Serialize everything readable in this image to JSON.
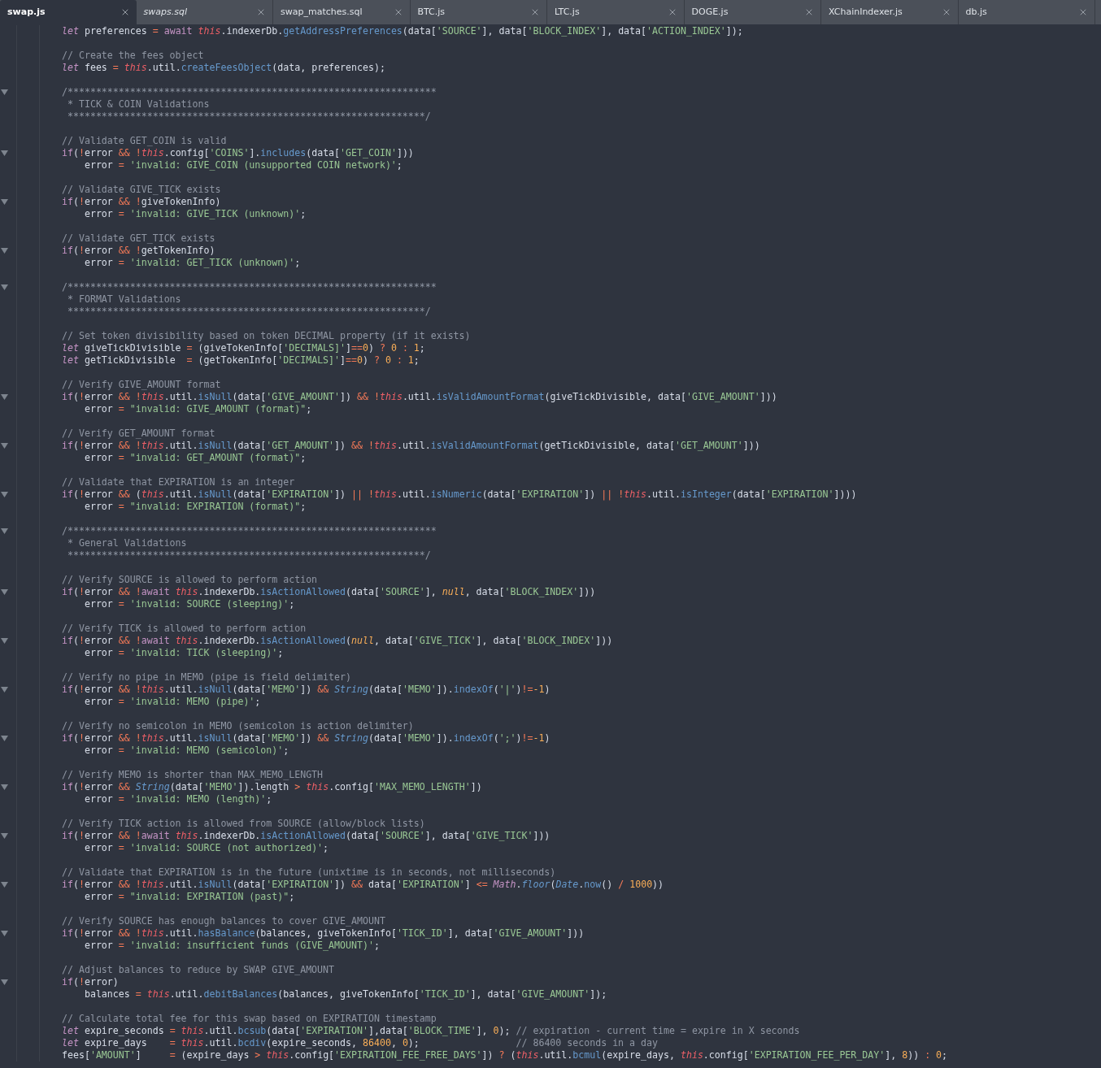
{
  "tabs": [
    {
      "label": "swap.js",
      "selected": true,
      "preview": false
    },
    {
      "label": "swaps.sql",
      "selected": false,
      "preview": true
    },
    {
      "label": "swap_matches.sql",
      "selected": false,
      "preview": false
    },
    {
      "label": "BTC.js",
      "selected": false,
      "preview": false
    },
    {
      "label": "LTC.js",
      "selected": false,
      "preview": false
    },
    {
      "label": "DOGE.js",
      "selected": false,
      "preview": false
    },
    {
      "label": "XChainIndexer.js",
      "selected": false,
      "preview": false
    },
    {
      "label": "db.js",
      "selected": false,
      "preview": false
    }
  ],
  "lines": [
    {
      "fold": false,
      "tokens": [
        {
          "kind": "storage",
          "text": "let"
        },
        {
          "kind": "text",
          "text": " preferences "
        },
        {
          "kind": "operator",
          "text": "= "
        },
        {
          "kind": "keyword",
          "text": "await "
        },
        {
          "kind": "self",
          "text": "this"
        },
        {
          "kind": "text",
          "text": ".indexerDb."
        },
        {
          "kind": "call",
          "text": "getAddressPreferences"
        },
        {
          "kind": "text",
          "text": "(data["
        },
        {
          "kind": "string",
          "text": "'SOURCE'"
        },
        {
          "kind": "text",
          "text": "], data["
        },
        {
          "kind": "string",
          "text": "'BLOCK_INDEX'"
        },
        {
          "kind": "text",
          "text": "], data["
        },
        {
          "kind": "string",
          "text": "'ACTION_INDEX'"
        },
        {
          "kind": "text",
          "text": "]);"
        }
      ]
    },
    {
      "fold": false
    },
    {
      "fold": false,
      "tokens": [
        {
          "kind": "comment",
          "text": "// Create the fees object"
        }
      ]
    },
    {
      "fold": false,
      "tokens": [
        {
          "kind": "storage",
          "text": "let"
        },
        {
          "kind": "text",
          "text": " fees "
        },
        {
          "kind": "operator",
          "text": "= "
        },
        {
          "kind": "self",
          "text": "this"
        },
        {
          "kind": "text",
          "text": ".util."
        },
        {
          "kind": "call",
          "text": "createFeesObject"
        },
        {
          "kind": "text",
          "text": "(data, preferences);"
        }
      ]
    },
    {
      "fold": false
    },
    {
      "fold": true,
      "tokens": [
        {
          "kind": "comment",
          "text": "/*****************************************************************"
        }
      ]
    },
    {
      "fold": false,
      "tokens": [
        {
          "kind": "comment",
          "text": " * TICK & COIN Validations"
        }
      ]
    },
    {
      "fold": false,
      "tokens": [
        {
          "kind": "comment",
          "text": " ***************************************************************/"
        }
      ]
    },
    {
      "fold": false
    },
    {
      "fold": false,
      "tokens": [
        {
          "kind": "comment",
          "text": "// Validate GET_COIN is valid"
        }
      ]
    },
    {
      "fold": true,
      "tokens": [
        {
          "kind": "keyword",
          "text": "if"
        },
        {
          "kind": "text",
          "text": "("
        },
        {
          "kind": "operator",
          "text": "!"
        },
        {
          "kind": "text",
          "text": "error "
        },
        {
          "kind": "operator",
          "text": "&& !"
        },
        {
          "kind": "self",
          "text": "this"
        },
        {
          "kind": "text",
          "text": ".config["
        },
        {
          "kind": "string",
          "text": "'COINS'"
        },
        {
          "kind": "text",
          "text": "]."
        },
        {
          "kind": "call",
          "text": "includes"
        },
        {
          "kind": "text",
          "text": "(data["
        },
        {
          "kind": "string",
          "text": "'GET_COIN'"
        },
        {
          "kind": "text",
          "text": "]))"
        }
      ]
    },
    {
      "fold": false,
      "tokens": [
        {
          "kind": "text",
          "text": "    error "
        },
        {
          "kind": "operator",
          "text": "= "
        },
        {
          "kind": "string",
          "text": "'invalid: GIVE_COIN (unsupported COIN network)'"
        },
        {
          "kind": "text",
          "text": ";"
        }
      ]
    },
    {
      "fold": false
    },
    {
      "fold": false,
      "tokens": [
        {
          "kind": "comment",
          "text": "// Validate GIVE_TICK exists"
        }
      ]
    },
    {
      "fold": true,
      "tokens": [
        {
          "kind": "keyword",
          "text": "if"
        },
        {
          "kind": "text",
          "text": "("
        },
        {
          "kind": "operator",
          "text": "!"
        },
        {
          "kind": "text",
          "text": "error "
        },
        {
          "kind": "operator",
          "text": "&& !"
        },
        {
          "kind": "text",
          "text": "giveTokenInfo)"
        }
      ]
    },
    {
      "fold": false,
      "tokens": [
        {
          "kind": "text",
          "text": "    error "
        },
        {
          "kind": "operator",
          "text": "= "
        },
        {
          "kind": "string",
          "text": "'invalid: GIVE_TICK (unknown)'"
        },
        {
          "kind": "text",
          "text": ";"
        }
      ]
    },
    {
      "fold": false
    },
    {
      "fold": false,
      "tokens": [
        {
          "kind": "comment",
          "text": "// Validate GET_TICK exists"
        }
      ]
    },
    {
      "fold": true,
      "tokens": [
        {
          "kind": "keyword",
          "text": "if"
        },
        {
          "kind": "text",
          "text": "("
        },
        {
          "kind": "operator",
          "text": "!"
        },
        {
          "kind": "text",
          "text": "error "
        },
        {
          "kind": "operator",
          "text": "&& !"
        },
        {
          "kind": "text",
          "text": "getTokenInfo)"
        }
      ]
    },
    {
      "fold": false,
      "tokens": [
        {
          "kind": "text",
          "text": "    error "
        },
        {
          "kind": "operator",
          "text": "= "
        },
        {
          "kind": "string",
          "text": "'invalid: GET_TICK (unknown)'"
        },
        {
          "kind": "text",
          "text": ";"
        }
      ]
    },
    {
      "fold": false
    },
    {
      "fold": true,
      "tokens": [
        {
          "kind": "comment",
          "text": "/*****************************************************************"
        }
      ]
    },
    {
      "fold": false,
      "tokens": [
        {
          "kind": "comment",
          "text": " * FORMAT Validations"
        }
      ]
    },
    {
      "fold": false,
      "tokens": [
        {
          "kind": "comment",
          "text": " ***************************************************************/"
        }
      ]
    },
    {
      "fold": false
    },
    {
      "fold": false,
      "tokens": [
        {
          "kind": "comment",
          "text": "// Set token divisibility based on token DECIMAL property (if it exists)"
        }
      ]
    },
    {
      "fold": false,
      "tokens": [
        {
          "kind": "storage",
          "text": "let"
        },
        {
          "kind": "text",
          "text": " giveTickDivisible "
        },
        {
          "kind": "operator",
          "text": "="
        },
        {
          "kind": "text",
          "text": " (giveTokenInfo["
        },
        {
          "kind": "string",
          "text": "'DECIMALS]'"
        },
        {
          "kind": "text",
          "text": "]"
        },
        {
          "kind": "operator",
          "text": "=="
        },
        {
          "kind": "number",
          "text": "0"
        },
        {
          "kind": "text",
          "text": ") "
        },
        {
          "kind": "operator",
          "text": "? "
        },
        {
          "kind": "number",
          "text": "0 "
        },
        {
          "kind": "operator",
          "text": ": "
        },
        {
          "kind": "number",
          "text": "1"
        },
        {
          "kind": "text",
          "text": ";"
        }
      ]
    },
    {
      "fold": false,
      "tokens": [
        {
          "kind": "storage",
          "text": "let"
        },
        {
          "kind": "text",
          "text": " getTickDivisible  "
        },
        {
          "kind": "operator",
          "text": "="
        },
        {
          "kind": "text",
          "text": " (getTokenInfo["
        },
        {
          "kind": "string",
          "text": "'DECIMALS]'"
        },
        {
          "kind": "text",
          "text": "]"
        },
        {
          "kind": "operator",
          "text": "=="
        },
        {
          "kind": "number",
          "text": "0"
        },
        {
          "kind": "text",
          "text": ") "
        },
        {
          "kind": "operator",
          "text": "? "
        },
        {
          "kind": "number",
          "text": "0 "
        },
        {
          "kind": "operator",
          "text": ": "
        },
        {
          "kind": "number",
          "text": "1"
        },
        {
          "kind": "text",
          "text": ";"
        }
      ]
    },
    {
      "fold": false
    },
    {
      "fold": false,
      "tokens": [
        {
          "kind": "comment",
          "text": "// Verify GIVE_AMOUNT format"
        }
      ]
    },
    {
      "fold": true,
      "tokens": [
        {
          "kind": "keyword",
          "text": "if"
        },
        {
          "kind": "text",
          "text": "("
        },
        {
          "kind": "operator",
          "text": "!"
        },
        {
          "kind": "text",
          "text": "error "
        },
        {
          "kind": "operator",
          "text": "&& !"
        },
        {
          "kind": "self",
          "text": "this"
        },
        {
          "kind": "text",
          "text": ".util."
        },
        {
          "kind": "call",
          "text": "isNull"
        },
        {
          "kind": "text",
          "text": "(data["
        },
        {
          "kind": "string",
          "text": "'GIVE_AMOUNT'"
        },
        {
          "kind": "text",
          "text": "]) "
        },
        {
          "kind": "operator",
          "text": "&& !"
        },
        {
          "kind": "self",
          "text": "this"
        },
        {
          "kind": "text",
          "text": ".util."
        },
        {
          "kind": "call",
          "text": "isValidAmountFormat"
        },
        {
          "kind": "text",
          "text": "(giveTickDivisible, data["
        },
        {
          "kind": "string",
          "text": "'GIVE_AMOUNT'"
        },
        {
          "kind": "text",
          "text": "]))"
        }
      ]
    },
    {
      "fold": false,
      "tokens": [
        {
          "kind": "text",
          "text": "    error "
        },
        {
          "kind": "operator",
          "text": "= "
        },
        {
          "kind": "string",
          "text": "\"invalid: GIVE_AMOUNT (format)\""
        },
        {
          "kind": "text",
          "text": ";"
        }
      ]
    },
    {
      "fold": false
    },
    {
      "fold": false,
      "tokens": [
        {
          "kind": "comment",
          "text": "// Verify GET_AMOUNT format"
        }
      ]
    },
    {
      "fold": true,
      "tokens": [
        {
          "kind": "keyword",
          "text": "if"
        },
        {
          "kind": "text",
          "text": "("
        },
        {
          "kind": "operator",
          "text": "!"
        },
        {
          "kind": "text",
          "text": "error "
        },
        {
          "kind": "operator",
          "text": "&& !"
        },
        {
          "kind": "self",
          "text": "this"
        },
        {
          "kind": "text",
          "text": ".util."
        },
        {
          "kind": "call",
          "text": "isNull"
        },
        {
          "kind": "text",
          "text": "(data["
        },
        {
          "kind": "string",
          "text": "'GET_AMOUNT'"
        },
        {
          "kind": "text",
          "text": "]) "
        },
        {
          "kind": "operator",
          "text": "&& !"
        },
        {
          "kind": "self",
          "text": "this"
        },
        {
          "kind": "text",
          "text": ".util."
        },
        {
          "kind": "call",
          "text": "isValidAmountFormat"
        },
        {
          "kind": "text",
          "text": "(getTickDivisible, data["
        },
        {
          "kind": "string",
          "text": "'GET_AMOUNT'"
        },
        {
          "kind": "text",
          "text": "]))"
        }
      ]
    },
    {
      "fold": false,
      "tokens": [
        {
          "kind": "text",
          "text": "    error "
        },
        {
          "kind": "operator",
          "text": "= "
        },
        {
          "kind": "string",
          "text": "\"invalid: GET_AMOUNT (format)\""
        },
        {
          "kind": "text",
          "text": ";"
        }
      ]
    },
    {
      "fold": false
    },
    {
      "fold": false,
      "tokens": [
        {
          "kind": "comment",
          "text": "// Validate that EXPIRATION is an integer"
        }
      ]
    },
    {
      "fold": true,
      "tokens": [
        {
          "kind": "keyword",
          "text": "if"
        },
        {
          "kind": "text",
          "text": "("
        },
        {
          "kind": "operator",
          "text": "!"
        },
        {
          "kind": "text",
          "text": "error "
        },
        {
          "kind": "operator",
          "text": "&&"
        },
        {
          "kind": "text",
          "text": " ("
        },
        {
          "kind": "self",
          "text": "this"
        },
        {
          "kind": "text",
          "text": ".util."
        },
        {
          "kind": "call",
          "text": "isNull"
        },
        {
          "kind": "text",
          "text": "(data["
        },
        {
          "kind": "string",
          "text": "'EXPIRATION'"
        },
        {
          "kind": "text",
          "text": "]) "
        },
        {
          "kind": "operator",
          "text": "|| !"
        },
        {
          "kind": "self",
          "text": "this"
        },
        {
          "kind": "text",
          "text": ".util."
        },
        {
          "kind": "call",
          "text": "isNumeric"
        },
        {
          "kind": "text",
          "text": "(data["
        },
        {
          "kind": "string",
          "text": "'EXPIRATION'"
        },
        {
          "kind": "text",
          "text": "]) "
        },
        {
          "kind": "operator",
          "text": "|| !"
        },
        {
          "kind": "self",
          "text": "this"
        },
        {
          "kind": "text",
          "text": ".util."
        },
        {
          "kind": "call",
          "text": "isInteger"
        },
        {
          "kind": "text",
          "text": "(data["
        },
        {
          "kind": "string",
          "text": "'EXPIRATION'"
        },
        {
          "kind": "text",
          "text": "])))"
        }
      ]
    },
    {
      "fold": false,
      "tokens": [
        {
          "kind": "text",
          "text": "    error "
        },
        {
          "kind": "operator",
          "text": "= "
        },
        {
          "kind": "string",
          "text": "\"invalid: EXPIRATION (format)\""
        },
        {
          "kind": "text",
          "text": ";"
        }
      ]
    },
    {
      "fold": false
    },
    {
      "fold": true,
      "tokens": [
        {
          "kind": "comment",
          "text": "/*****************************************************************"
        }
      ]
    },
    {
      "fold": false,
      "tokens": [
        {
          "kind": "comment",
          "text": " * General Validations"
        }
      ]
    },
    {
      "fold": false,
      "tokens": [
        {
          "kind": "comment",
          "text": " ***************************************************************/"
        }
      ]
    },
    {
      "fold": false
    },
    {
      "fold": false,
      "tokens": [
        {
          "kind": "comment",
          "text": "// Verify SOURCE is allowed to perform action"
        }
      ]
    },
    {
      "fold": true,
      "tokens": [
        {
          "kind": "keyword",
          "text": "if"
        },
        {
          "kind": "text",
          "text": "("
        },
        {
          "kind": "operator",
          "text": "!"
        },
        {
          "kind": "text",
          "text": "error "
        },
        {
          "kind": "operator",
          "text": "&& !"
        },
        {
          "kind": "keyword",
          "text": "await "
        },
        {
          "kind": "self",
          "text": "this"
        },
        {
          "kind": "text",
          "text": ".indexerDb."
        },
        {
          "kind": "call",
          "text": "isActionAllowed"
        },
        {
          "kind": "text",
          "text": "(data["
        },
        {
          "kind": "string",
          "text": "'SOURCE'"
        },
        {
          "kind": "text",
          "text": "], "
        },
        {
          "kind": "constant",
          "text": "null"
        },
        {
          "kind": "text",
          "text": ", data["
        },
        {
          "kind": "string",
          "text": "'BLOCK_INDEX'"
        },
        {
          "kind": "text",
          "text": "]))"
        }
      ]
    },
    {
      "fold": false,
      "tokens": [
        {
          "kind": "text",
          "text": "    error "
        },
        {
          "kind": "operator",
          "text": "= "
        },
        {
          "kind": "string",
          "text": "'invalid: SOURCE (sleeping)'"
        },
        {
          "kind": "text",
          "text": ";"
        }
      ]
    },
    {
      "fold": false
    },
    {
      "fold": false,
      "tokens": [
        {
          "kind": "comment",
          "text": "// Verify TICK is allowed to perform action"
        }
      ]
    },
    {
      "fold": true,
      "tokens": [
        {
          "kind": "keyword",
          "text": "if"
        },
        {
          "kind": "text",
          "text": "("
        },
        {
          "kind": "operator",
          "text": "!"
        },
        {
          "kind": "text",
          "text": "error "
        },
        {
          "kind": "operator",
          "text": "&& !"
        },
        {
          "kind": "keyword",
          "text": "await "
        },
        {
          "kind": "self",
          "text": "this"
        },
        {
          "kind": "text",
          "text": ".indexerDb."
        },
        {
          "kind": "call",
          "text": "isActionAllowed"
        },
        {
          "kind": "text",
          "text": "("
        },
        {
          "kind": "constant",
          "text": "null"
        },
        {
          "kind": "text",
          "text": ", data["
        },
        {
          "kind": "string",
          "text": "'GIVE_TICK'"
        },
        {
          "kind": "text",
          "text": "], data["
        },
        {
          "kind": "string",
          "text": "'BLOCK_INDEX'"
        },
        {
          "kind": "text",
          "text": "]))"
        }
      ]
    },
    {
      "fold": false,
      "tokens": [
        {
          "kind": "text",
          "text": "    error "
        },
        {
          "kind": "operator",
          "text": "= "
        },
        {
          "kind": "string",
          "text": "'invalid: TICK (sleeping)'"
        },
        {
          "kind": "text",
          "text": ";"
        }
      ]
    },
    {
      "fold": false
    },
    {
      "fold": false,
      "tokens": [
        {
          "kind": "comment",
          "text": "// Verify no pipe in MEMO (pipe is field delimiter)"
        }
      ]
    },
    {
      "fold": true,
      "tokens": [
        {
          "kind": "keyword",
          "text": "if"
        },
        {
          "kind": "text",
          "text": "("
        },
        {
          "kind": "operator",
          "text": "!"
        },
        {
          "kind": "text",
          "text": "error "
        },
        {
          "kind": "operator",
          "text": "&& !"
        },
        {
          "kind": "self",
          "text": "this"
        },
        {
          "kind": "text",
          "text": ".util."
        },
        {
          "kind": "call",
          "text": "isNull"
        },
        {
          "kind": "text",
          "text": "(data["
        },
        {
          "kind": "string",
          "text": "'MEMO'"
        },
        {
          "kind": "text",
          "text": "]) "
        },
        {
          "kind": "operator",
          "text": "&& "
        },
        {
          "kind": "type",
          "text": "String"
        },
        {
          "kind": "text",
          "text": "(data["
        },
        {
          "kind": "string",
          "text": "'MEMO'"
        },
        {
          "kind": "text",
          "text": "])."
        },
        {
          "kind": "call",
          "text": "indexOf"
        },
        {
          "kind": "text",
          "text": "("
        },
        {
          "kind": "string",
          "text": "'|'"
        },
        {
          "kind": "text",
          "text": ")"
        },
        {
          "kind": "operator",
          "text": "!="
        },
        {
          "kind": "number",
          "text": "-1"
        },
        {
          "kind": "text",
          "text": ")"
        }
      ]
    },
    {
      "fold": false,
      "tokens": [
        {
          "kind": "text",
          "text": "    error "
        },
        {
          "kind": "operator",
          "text": "= "
        },
        {
          "kind": "string",
          "text": "'invalid: MEMO (pipe)'"
        },
        {
          "kind": "text",
          "text": ";"
        }
      ]
    },
    {
      "fold": false
    },
    {
      "fold": false,
      "tokens": [
        {
          "kind": "comment",
          "text": "// Verify no semicolon in MEMO (semicolon is action delimiter)"
        }
      ]
    },
    {
      "fold": true,
      "tokens": [
        {
          "kind": "keyword",
          "text": "if"
        },
        {
          "kind": "text",
          "text": "("
        },
        {
          "kind": "operator",
          "text": "!"
        },
        {
          "kind": "text",
          "text": "error "
        },
        {
          "kind": "operator",
          "text": "&& !"
        },
        {
          "kind": "self",
          "text": "this"
        },
        {
          "kind": "text",
          "text": ".util."
        },
        {
          "kind": "call",
          "text": "isNull"
        },
        {
          "kind": "text",
          "text": "(data["
        },
        {
          "kind": "string",
          "text": "'MEMO'"
        },
        {
          "kind": "text",
          "text": "]) "
        },
        {
          "kind": "operator",
          "text": "&& "
        },
        {
          "kind": "type",
          "text": "String"
        },
        {
          "kind": "text",
          "text": "(data["
        },
        {
          "kind": "string",
          "text": "'MEMO'"
        },
        {
          "kind": "text",
          "text": "])."
        },
        {
          "kind": "call",
          "text": "indexOf"
        },
        {
          "kind": "text",
          "text": "("
        },
        {
          "kind": "string",
          "text": "';'"
        },
        {
          "kind": "text",
          "text": ")"
        },
        {
          "kind": "operator",
          "text": "!="
        },
        {
          "kind": "number",
          "text": "-1"
        },
        {
          "kind": "text",
          "text": ")"
        }
      ]
    },
    {
      "fold": false,
      "tokens": [
        {
          "kind": "text",
          "text": "    error "
        },
        {
          "kind": "operator",
          "text": "= "
        },
        {
          "kind": "string",
          "text": "'invalid: MEMO (semicolon)'"
        },
        {
          "kind": "text",
          "text": ";"
        }
      ]
    },
    {
      "fold": false
    },
    {
      "fold": false,
      "tokens": [
        {
          "kind": "comment",
          "text": "// Verify MEMO is shorter than MAX_MEMO_LENGTH"
        }
      ]
    },
    {
      "fold": true,
      "tokens": [
        {
          "kind": "keyword",
          "text": "if"
        },
        {
          "kind": "text",
          "text": "("
        },
        {
          "kind": "operator",
          "text": "!"
        },
        {
          "kind": "text",
          "text": "error "
        },
        {
          "kind": "operator",
          "text": "&& "
        },
        {
          "kind": "type",
          "text": "String"
        },
        {
          "kind": "text",
          "text": "(data["
        },
        {
          "kind": "string",
          "text": "'MEMO'"
        },
        {
          "kind": "text",
          "text": "]).length "
        },
        {
          "kind": "operator",
          "text": "> "
        },
        {
          "kind": "self",
          "text": "this"
        },
        {
          "kind": "text",
          "text": ".config["
        },
        {
          "kind": "string",
          "text": "'MAX_MEMO_LENGTH'"
        },
        {
          "kind": "text",
          "text": "])"
        }
      ]
    },
    {
      "fold": false,
      "tokens": [
        {
          "kind": "text",
          "text": "    error "
        },
        {
          "kind": "operator",
          "text": "= "
        },
        {
          "kind": "string",
          "text": "'invalid: MEMO (length)'"
        },
        {
          "kind": "text",
          "text": ";"
        }
      ]
    },
    {
      "fold": false
    },
    {
      "fold": false,
      "tokens": [
        {
          "kind": "comment",
          "text": "// Verify TICK action is allowed from SOURCE (allow/block lists)"
        }
      ]
    },
    {
      "fold": true,
      "tokens": [
        {
          "kind": "keyword",
          "text": "if"
        },
        {
          "kind": "text",
          "text": "("
        },
        {
          "kind": "operator",
          "text": "!"
        },
        {
          "kind": "text",
          "text": "error "
        },
        {
          "kind": "operator",
          "text": "&& !"
        },
        {
          "kind": "keyword",
          "text": "await "
        },
        {
          "kind": "self",
          "text": "this"
        },
        {
          "kind": "text",
          "text": ".indexerDb."
        },
        {
          "kind": "call",
          "text": "isActionAllowed"
        },
        {
          "kind": "text",
          "text": "(data["
        },
        {
          "kind": "string",
          "text": "'SOURCE'"
        },
        {
          "kind": "text",
          "text": "], data["
        },
        {
          "kind": "string",
          "text": "'GIVE_TICK'"
        },
        {
          "kind": "text",
          "text": "]))"
        }
      ]
    },
    {
      "fold": false,
      "tokens": [
        {
          "kind": "text",
          "text": "    error "
        },
        {
          "kind": "operator",
          "text": "= "
        },
        {
          "kind": "string",
          "text": "'invalid: SOURCE (not authorized)'"
        },
        {
          "kind": "text",
          "text": ";"
        }
      ]
    },
    {
      "fold": false
    },
    {
      "fold": false,
      "tokens": [
        {
          "kind": "comment",
          "text": "// Validate that EXPIRATION is in the future (unixtime is in seconds, not milliseconds)"
        }
      ]
    },
    {
      "fold": true,
      "tokens": [
        {
          "kind": "keyword",
          "text": "if"
        },
        {
          "kind": "text",
          "text": "("
        },
        {
          "kind": "operator",
          "text": "!"
        },
        {
          "kind": "text",
          "text": "error "
        },
        {
          "kind": "operator",
          "text": "&& !"
        },
        {
          "kind": "self",
          "text": "this"
        },
        {
          "kind": "text",
          "text": ".util."
        },
        {
          "kind": "call",
          "text": "isNull"
        },
        {
          "kind": "text",
          "text": "(data["
        },
        {
          "kind": "string",
          "text": "'EXPIRATION'"
        },
        {
          "kind": "text",
          "text": "]) "
        },
        {
          "kind": "operator",
          "text": "&&"
        },
        {
          "kind": "text",
          "text": " data["
        },
        {
          "kind": "string",
          "text": "'EXPIRATION'"
        },
        {
          "kind": "text",
          "text": "] "
        },
        {
          "kind": "operator",
          "text": "<= "
        },
        {
          "kind": "storage",
          "text": "Math"
        },
        {
          "kind": "text",
          "text": "."
        },
        {
          "kind": "type",
          "text": "floor"
        },
        {
          "kind": "text",
          "text": "("
        },
        {
          "kind": "type",
          "text": "Date"
        },
        {
          "kind": "text",
          "text": "."
        },
        {
          "kind": "call",
          "text": "now"
        },
        {
          "kind": "text",
          "text": "() "
        },
        {
          "kind": "operator",
          "text": "/ "
        },
        {
          "kind": "number",
          "text": "1000"
        },
        {
          "kind": "text",
          "text": "))"
        }
      ]
    },
    {
      "fold": false,
      "tokens": [
        {
          "kind": "text",
          "text": "    error "
        },
        {
          "kind": "operator",
          "text": "= "
        },
        {
          "kind": "string",
          "text": "\"invalid: EXPIRATION (past)\""
        },
        {
          "kind": "text",
          "text": ";"
        }
      ]
    },
    {
      "fold": false
    },
    {
      "fold": false,
      "tokens": [
        {
          "kind": "comment",
          "text": "// Verify SOURCE has enough balances to cover GIVE_AMOUNT"
        }
      ]
    },
    {
      "fold": true,
      "tokens": [
        {
          "kind": "keyword",
          "text": "if"
        },
        {
          "kind": "text",
          "text": "("
        },
        {
          "kind": "operator",
          "text": "!"
        },
        {
          "kind": "text",
          "text": "error "
        },
        {
          "kind": "operator",
          "text": "&& !"
        },
        {
          "kind": "self",
          "text": "this"
        },
        {
          "kind": "text",
          "text": ".util."
        },
        {
          "kind": "call",
          "text": "hasBalance"
        },
        {
          "kind": "text",
          "text": "(balances, giveTokenInfo["
        },
        {
          "kind": "string",
          "text": "'TICK_ID'"
        },
        {
          "kind": "text",
          "text": "], data["
        },
        {
          "kind": "string",
          "text": "'GIVE_AMOUNT'"
        },
        {
          "kind": "text",
          "text": "]))"
        }
      ]
    },
    {
      "fold": false,
      "tokens": [
        {
          "kind": "text",
          "text": "    error "
        },
        {
          "kind": "operator",
          "text": "= "
        },
        {
          "kind": "string",
          "text": "'invalid: insufficient funds (GIVE_AMOUNT)'"
        },
        {
          "kind": "text",
          "text": ";"
        }
      ]
    },
    {
      "fold": false
    },
    {
      "fold": false,
      "tokens": [
        {
          "kind": "comment",
          "text": "// Adjust balances to reduce by SWAP GIVE_AMOUNT"
        }
      ]
    },
    {
      "fold": true,
      "tokens": [
        {
          "kind": "keyword",
          "text": "if"
        },
        {
          "kind": "text",
          "text": "("
        },
        {
          "kind": "operator",
          "text": "!"
        },
        {
          "kind": "text",
          "text": "error)"
        }
      ]
    },
    {
      "fold": false,
      "tokens": [
        {
          "kind": "text",
          "text": "    balances "
        },
        {
          "kind": "operator",
          "text": "= "
        },
        {
          "kind": "self",
          "text": "this"
        },
        {
          "kind": "text",
          "text": ".util."
        },
        {
          "kind": "call",
          "text": "debitBalances"
        },
        {
          "kind": "text",
          "text": "(balances, giveTokenInfo["
        },
        {
          "kind": "string",
          "text": "'TICK_ID'"
        },
        {
          "kind": "text",
          "text": "], data["
        },
        {
          "kind": "string",
          "text": "'GIVE_AMOUNT'"
        },
        {
          "kind": "text",
          "text": "]);"
        }
      ]
    },
    {
      "fold": false
    },
    {
      "fold": false,
      "tokens": [
        {
          "kind": "comment",
          "text": "// Calculate total fee for this swap based on EXPIRATION timestamp"
        }
      ]
    },
    {
      "fold": false,
      "tokens": [
        {
          "kind": "storage",
          "text": "let"
        },
        {
          "kind": "text",
          "text": " expire_seconds "
        },
        {
          "kind": "operator",
          "text": "= "
        },
        {
          "kind": "self",
          "text": "this"
        },
        {
          "kind": "text",
          "text": ".util."
        },
        {
          "kind": "call",
          "text": "bcsub"
        },
        {
          "kind": "text",
          "text": "(data["
        },
        {
          "kind": "string",
          "text": "'EXPIRATION'"
        },
        {
          "kind": "text",
          "text": "],data["
        },
        {
          "kind": "string",
          "text": "'BLOCK_TIME'"
        },
        {
          "kind": "text",
          "text": "], "
        },
        {
          "kind": "number",
          "text": "0"
        },
        {
          "kind": "text",
          "text": "); "
        },
        {
          "kind": "comment",
          "text": "// expiration - current time = expire in X seconds"
        }
      ]
    },
    {
      "fold": false,
      "tokens": [
        {
          "kind": "storage",
          "text": "let"
        },
        {
          "kind": "text",
          "text": " expire_days    "
        },
        {
          "kind": "operator",
          "text": "= "
        },
        {
          "kind": "self",
          "text": "this"
        },
        {
          "kind": "text",
          "text": ".util."
        },
        {
          "kind": "call",
          "text": "bcdiv"
        },
        {
          "kind": "text",
          "text": "(expire_seconds, "
        },
        {
          "kind": "number",
          "text": "86400"
        },
        {
          "kind": "text",
          "text": ", "
        },
        {
          "kind": "number",
          "text": "0"
        },
        {
          "kind": "text",
          "text": ");                 "
        },
        {
          "kind": "comment",
          "text": "// 86400 seconds in a day"
        }
      ]
    },
    {
      "fold": false,
      "tokens": [
        {
          "kind": "text",
          "text": "fees["
        },
        {
          "kind": "string",
          "text": "'AMOUNT'"
        },
        {
          "kind": "text",
          "text": "]     "
        },
        {
          "kind": "operator",
          "text": "="
        },
        {
          "kind": "text",
          "text": " (expire_days "
        },
        {
          "kind": "operator",
          "text": "> "
        },
        {
          "kind": "self",
          "text": "this"
        },
        {
          "kind": "text",
          "text": ".config["
        },
        {
          "kind": "string",
          "text": "'EXPIRATION_FEE_FREE_DAYS'"
        },
        {
          "kind": "text",
          "text": "]) "
        },
        {
          "kind": "operator",
          "text": "?"
        },
        {
          "kind": "text",
          "text": " ("
        },
        {
          "kind": "self",
          "text": "this"
        },
        {
          "kind": "text",
          "text": ".util."
        },
        {
          "kind": "call",
          "text": "bcmul"
        },
        {
          "kind": "text",
          "text": "(expire_days, "
        },
        {
          "kind": "self",
          "text": "this"
        },
        {
          "kind": "text",
          "text": ".config["
        },
        {
          "kind": "string",
          "text": "'EXPIRATION_FEE_PER_DAY'"
        },
        {
          "kind": "text",
          "text": "], "
        },
        {
          "kind": "number",
          "text": "8"
        },
        {
          "kind": "text",
          "text": ")) "
        },
        {
          "kind": "operator",
          "text": ": "
        },
        {
          "kind": "number",
          "text": "0"
        },
        {
          "kind": "text",
          "text": ";"
        }
      ]
    }
  ]
}
